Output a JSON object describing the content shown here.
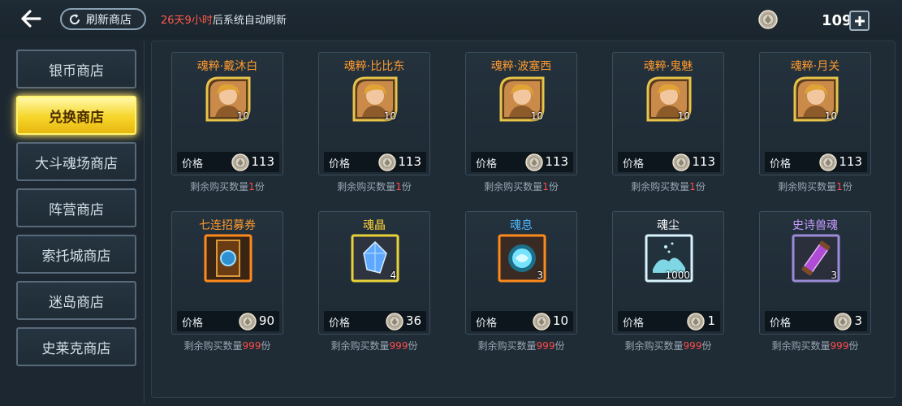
{
  "header": {
    "refresh_label": "刷新商店",
    "timer": {
      "highlight": "26天9小时",
      "rest": "后系统自动刷新"
    },
    "currency_amount": "109"
  },
  "sidebar": {
    "items": [
      {
        "label": "银币商店",
        "active": false
      },
      {
        "label": "兑换商店",
        "active": true
      },
      {
        "label": "大斗魂场商店",
        "active": false
      },
      {
        "label": "阵营商店",
        "active": false
      },
      {
        "label": "索托城商店",
        "active": false
      },
      {
        "label": "迷岛商店",
        "active": false
      },
      {
        "label": "史莱克商店",
        "active": false
      }
    ]
  },
  "shop": {
    "price_label": "价格",
    "remain_prefix": "剩余购买数量",
    "remain_suffix": "份",
    "items": [
      {
        "name": "魂粹·戴沐白",
        "name_color": "#ff9a2e",
        "qty": "10",
        "price": "113",
        "remain": "1",
        "icon": "hero-portrait-icon",
        "frame": "#e8c44a"
      },
      {
        "name": "魂粹·比比东",
        "name_color": "#ff9a2e",
        "qty": "10",
        "price": "113",
        "remain": "1",
        "icon": "hero-portrait-icon",
        "frame": "#e8c44a"
      },
      {
        "name": "魂粹·波塞西",
        "name_color": "#ff9a2e",
        "qty": "10",
        "price": "113",
        "remain": "1",
        "icon": "hero-portrait-icon",
        "frame": "#e8c44a"
      },
      {
        "name": "魂粹·鬼魅",
        "name_color": "#ff9a2e",
        "qty": "10",
        "price": "113",
        "remain": "1",
        "icon": "hero-portrait-icon",
        "frame": "#e8c44a"
      },
      {
        "name": "魂粹·月关",
        "name_color": "#ff9a2e",
        "qty": "10",
        "price": "113",
        "remain": "1",
        "icon": "hero-portrait-icon",
        "frame": "#e8c44a"
      },
      {
        "name": "七连招募券",
        "name_color": "#ff9a2e",
        "qty": "",
        "price": "90",
        "remain": "999",
        "icon": "recruit-ticket-icon",
        "frame": "#ff8a1c"
      },
      {
        "name": "魂晶",
        "name_color": "#ffd43a",
        "qty": "4",
        "price": "36",
        "remain": "999",
        "icon": "soul-crystal-icon",
        "frame": "#e8d23a"
      },
      {
        "name": "魂息",
        "name_color": "#4fb8ff",
        "qty": "3",
        "price": "10",
        "remain": "999",
        "icon": "soul-breath-icon",
        "frame": "#ff8a1c"
      },
      {
        "name": "魂尘",
        "name_color": "#ffffff",
        "qty": "1000",
        "price": "1",
        "remain": "999",
        "icon": "soul-dust-icon",
        "frame": "#d9f4ff"
      },
      {
        "name": "史诗兽魂",
        "name_color": "#c99bff",
        "qty": "3",
        "price": "3",
        "remain": "999",
        "icon": "beast-soul-icon",
        "frame": "#9b8bd8"
      }
    ]
  }
}
